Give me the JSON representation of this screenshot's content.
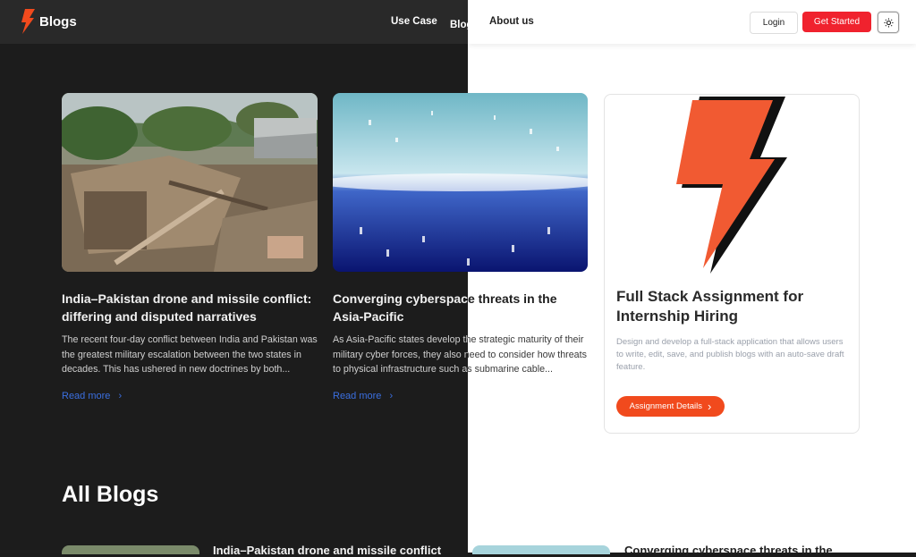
{
  "header": {
    "brand": "Blogs",
    "nav": [
      "Use Case",
      "Blogs",
      "About us"
    ],
    "login": "Login",
    "get_started": "Get Started",
    "theme_icon": "sun-icon"
  },
  "cards": [
    {
      "title": "India–Pakistan drone and missile conflict: differing and disputed narratives",
      "excerpt": "The recent four-day conflict between India and Pakistan was the greatest military escalation between the two states in decades. This has ushered in new doctrines by both...",
      "read_more": "Read more"
    },
    {
      "title": "Converging cyberspace threats in the Asia-Pacific",
      "excerpt": "As Asia-Pacific states develop the strategic maturity of their military cyber forces, they also need to consider how threats to physical infrastructure such as submarine cable...",
      "read_more": "Read more"
    }
  ],
  "assignment": {
    "title": "Full Stack Assignment for Internship Hiring",
    "description": "Design and develop a full-stack application that allows users to write, edit, save, and publish blogs with an auto-save draft feature.",
    "button": "Assignment Details"
  },
  "section_title": "All Blogs",
  "bottom_items": [
    {
      "title": "India–Pakistan drone and missile conflict"
    },
    {
      "title": "Converging cyberspace threats in the"
    }
  ],
  "colors": {
    "accent": "#f0222e",
    "orange": "#f14a1d",
    "link": "#3b6fe0"
  }
}
